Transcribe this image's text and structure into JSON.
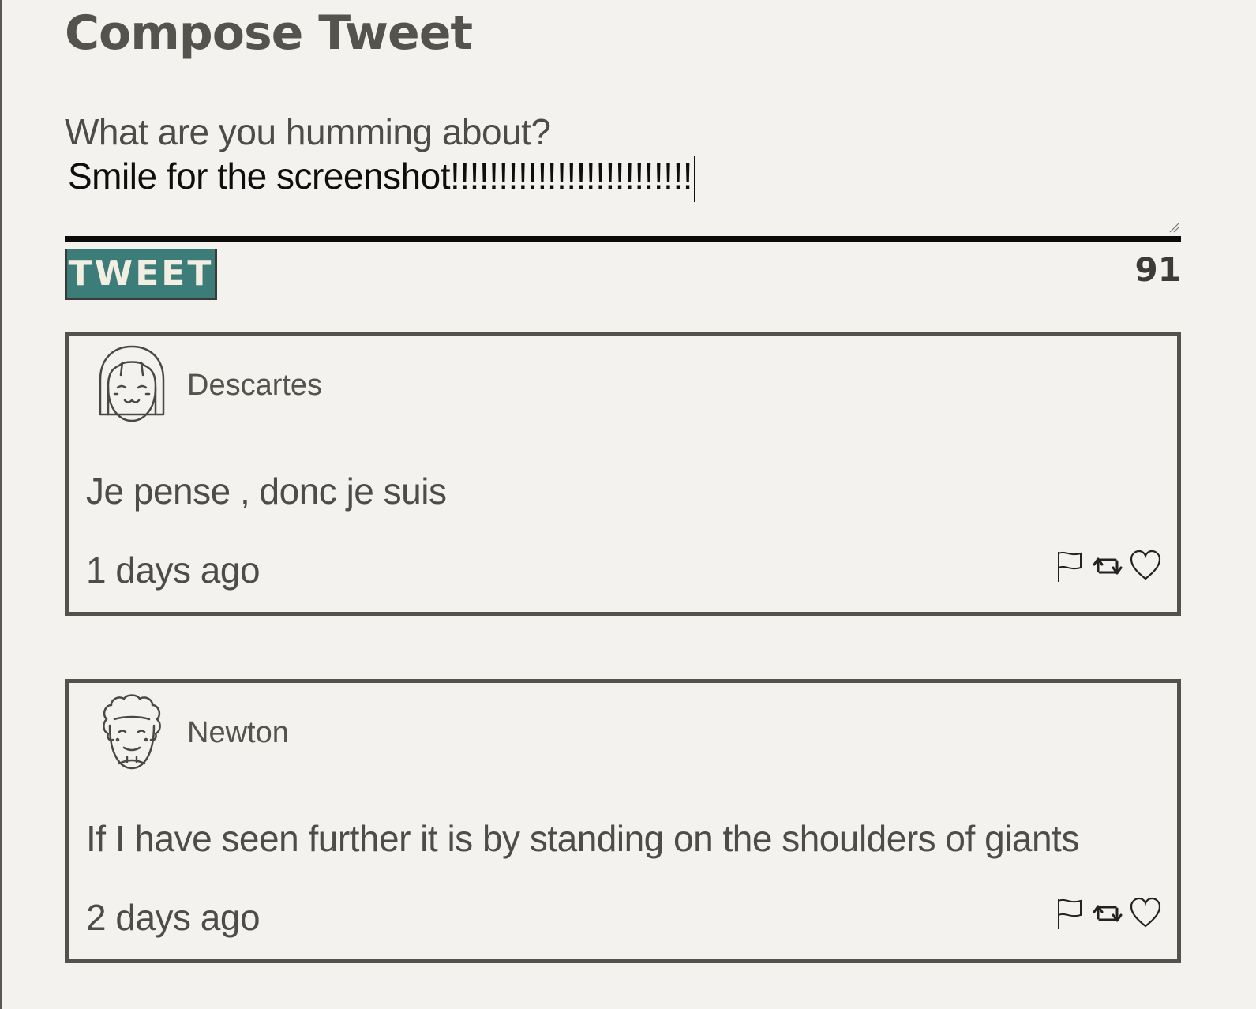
{
  "compose": {
    "title": "Compose Tweet",
    "prompt": "What are you humming about?",
    "input_value": "Smile for the screenshot!!!!!!!!!!!!!!!!!!!!!!!!!",
    "tweet_button_label": "TWEET",
    "char_count": "91"
  },
  "tweets": [
    {
      "author": "Descartes",
      "text": "Je pense , donc je suis",
      "time": "1 days ago",
      "avatar_icon": "girl-avatar-icon"
    },
    {
      "author": "Newton",
      "text": "If I have seen further it is by standing on the shoulders of giants",
      "time": "2 days ago",
      "avatar_icon": "curly-hair-avatar-icon"
    }
  ],
  "colors": {
    "background": "#f4f2ee",
    "accent": "#3c7d7a",
    "text": "#4d4b47",
    "border": "#54524d"
  },
  "icons": [
    "flag-icon",
    "retweet-icon",
    "heart-icon"
  ]
}
